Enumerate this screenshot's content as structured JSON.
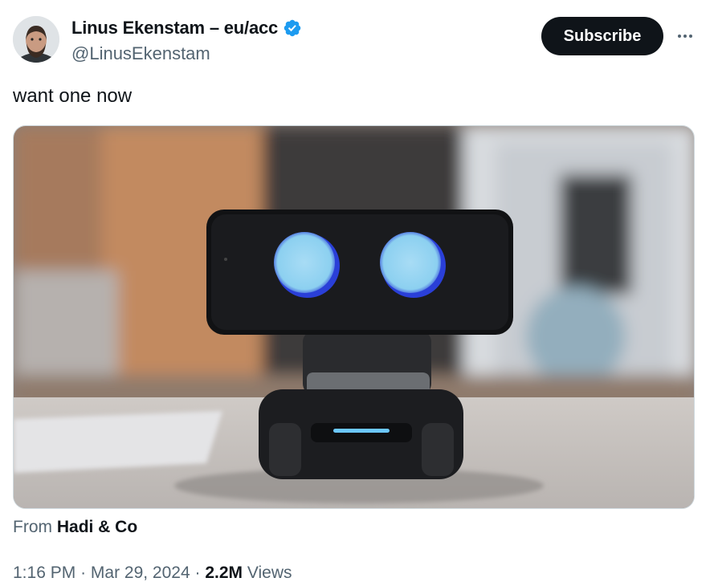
{
  "author": {
    "display_name": "Linus Ekenstam – eu/acc",
    "handle": "@LinusEkenstam",
    "verified": true
  },
  "actions": {
    "subscribe_label": "Subscribe",
    "more_icon": "more-horizontal-icon"
  },
  "tweet": {
    "text": "want one now"
  },
  "media_source": {
    "prefix": "From",
    "name": "Hadi & Co"
  },
  "meta": {
    "time": "1:16 PM",
    "separator": "·",
    "date": "Mar 29, 2024",
    "views_count": "2.2M",
    "views_label": "Views"
  },
  "colors": {
    "text": "#0f1419",
    "secondary": "#536471",
    "verified_blue": "#1d9bf0",
    "button_bg": "#0f1419"
  }
}
